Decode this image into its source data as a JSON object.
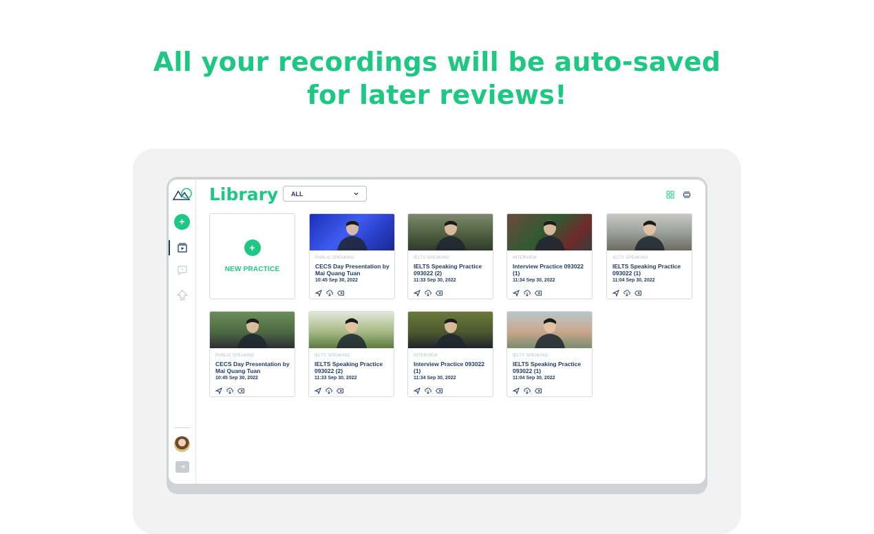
{
  "headline": {
    "line1": "All your recordings will be auto-saved",
    "line2": "for later reviews!"
  },
  "colors": {
    "brand": "#1ec882",
    "navy": "#1d3a5f",
    "muted": "#b6bcc2"
  },
  "sidebar": {
    "items": [
      {
        "name": "new-recording",
        "icon": "plus-icon"
      },
      {
        "name": "library",
        "icon": "library-icon",
        "active": true
      },
      {
        "name": "feedback",
        "icon": "chat-icon"
      },
      {
        "name": "upload",
        "icon": "upload-icon"
      }
    ],
    "logout_icon": "logout-icon"
  },
  "library": {
    "title": "Library",
    "filter": {
      "selected": "ALL"
    },
    "new_practice_label": "NEW PRACTICE",
    "cards": [
      {
        "category": "PUBLIC SPEAKING",
        "title": "CECS Day Presentation by Mai Quang Tuan",
        "date": "10:45 Sep 30, 2022",
        "thumb": "stage-blue"
      },
      {
        "category": "IELTS SPEAKING",
        "title": "IELTS Speaking Practice 093022 (2)",
        "date": "11:33 Sep 30, 2022",
        "thumb": "garden"
      },
      {
        "category": "INTERVIEW",
        "title": "Interview Practice 093022 (1)",
        "date": "11:34 Sep 30, 2022",
        "thumb": "tree"
      },
      {
        "category": "IELTS SPEAKING",
        "title": "IELTS Speaking Practice 093022 (1)",
        "date": "11:04 Sep 30, 2022",
        "thumb": "street"
      },
      {
        "category": "PUBLIC SPEAKING",
        "title": "CECS Day Presentation by Mai Quang Tuan",
        "date": "10:45 Sep 30, 2022",
        "thumb": "green"
      },
      {
        "category": "IELTS SPEAKING",
        "title": "IELTS Speaking Practice 093022 (2)",
        "date": "11:33 Sep 30, 2022",
        "thumb": "bright"
      },
      {
        "category": "INTERVIEW",
        "title": "Interview Practice 093022 (1)",
        "date": "11:34 Sep 30, 2022",
        "thumb": "olive"
      },
      {
        "category": "IELTS SPEAKING",
        "title": "IELTS Speaking Practice 093022 (1)",
        "date": "11:04 Sep 30, 2022",
        "thumb": "closeup"
      }
    ],
    "card_actions": [
      "share-icon",
      "download-icon",
      "delete-icon"
    ]
  }
}
